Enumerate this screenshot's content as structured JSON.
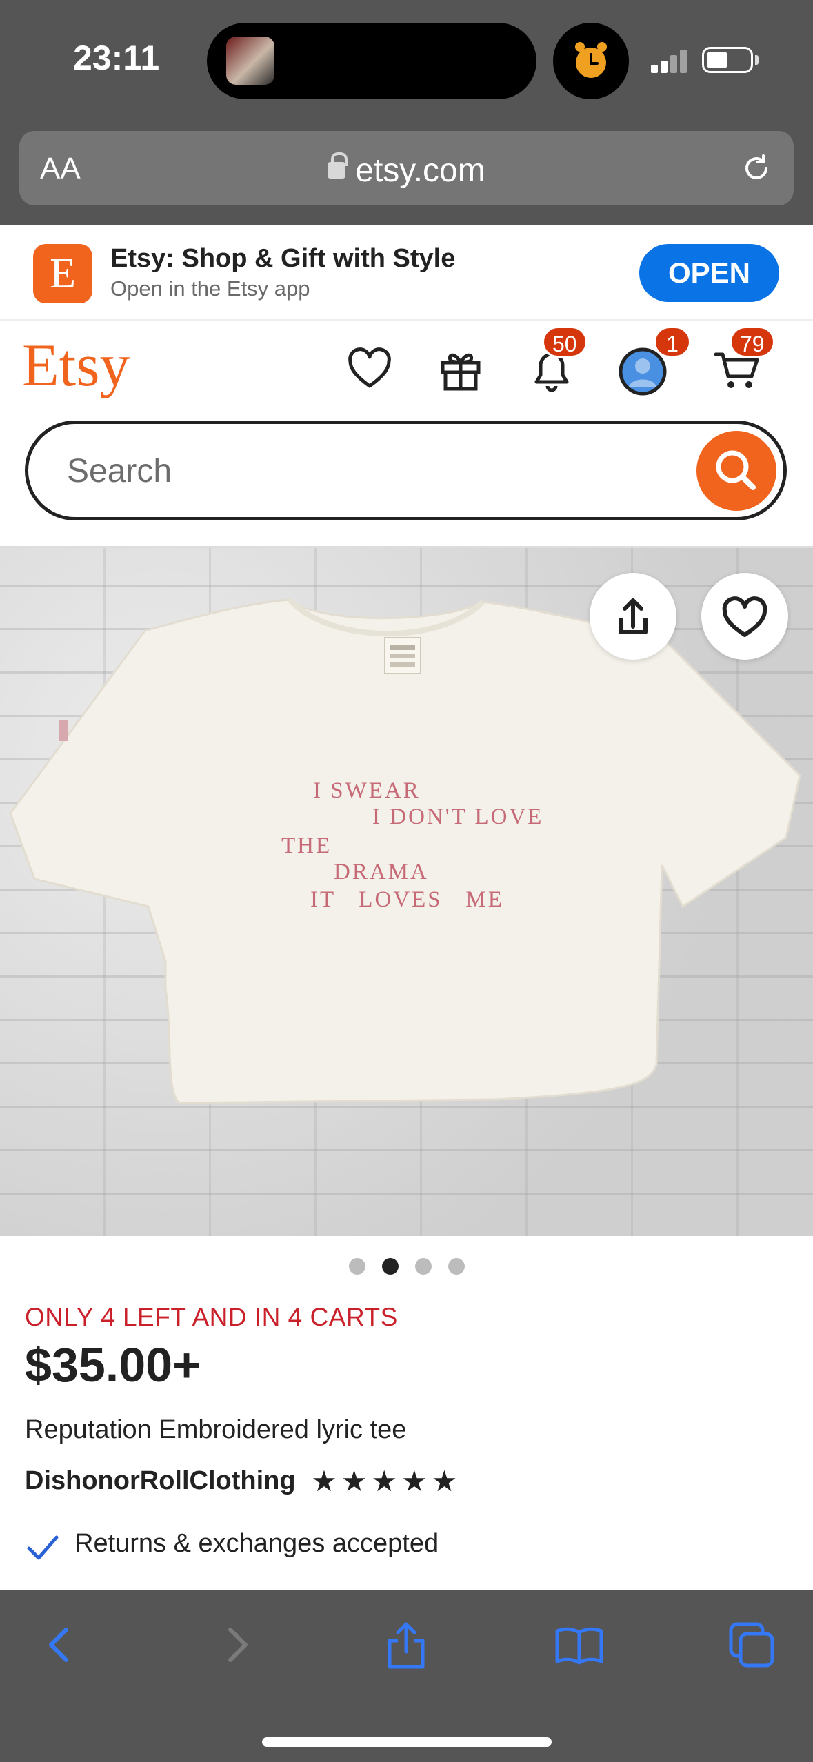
{
  "status_bar": {
    "time": "23:11"
  },
  "browser": {
    "aa_label": "AA",
    "url": "etsy.com"
  },
  "app_banner": {
    "icon_letter": "E",
    "title": "Etsy: Shop & Gift with Style",
    "subtitle": "Open in the Etsy app",
    "open_label": "OPEN"
  },
  "header": {
    "logo": "Etsy",
    "notifications_count": "50",
    "account_count": "1",
    "cart_count": "79",
    "search_placeholder": "Search"
  },
  "product": {
    "image_lyrics": [
      "I SWEAR",
      "I DON'T LOVE",
      "THE",
      "DRAMA",
      "IT   LOVES   ME"
    ],
    "carousel": {
      "count": 4,
      "active_index": 1
    },
    "scarcity": "ONLY 4 LEFT AND IN 4 CARTS",
    "price": "$35.00+",
    "title": "Reputation Embroidered lyric tee",
    "shop_name": "DishonorRollClothing",
    "rating_stars": 5,
    "stars_text": "★★★★★",
    "returns_text": "Returns & exchanges accepted"
  },
  "colors": {
    "etsy_orange": "#f1641e",
    "badge_red": "#d6360c",
    "open_blue": "#0a74e6",
    "scarcity_red": "#c9202a",
    "ios_link_blue": "#3478f6"
  }
}
